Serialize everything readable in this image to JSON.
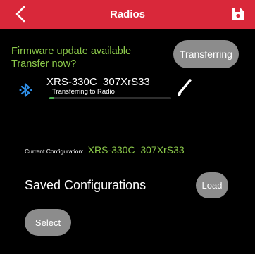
{
  "header": {
    "title": "Radios",
    "back_icon": "chevron-left-icon",
    "save_icon": "floppy-disk-icon",
    "background": "#d9283a"
  },
  "firmware": {
    "line1": "Firmware update available",
    "line2": "Transfer now?",
    "button_label": "Transferring",
    "text_color": "#8bc94a"
  },
  "device": {
    "icon": "bluetooth-icon",
    "name": "XRS-330C_307XrS33",
    "status": "Transferring to Radio",
    "progress": 0.04,
    "edit_icon": "pencil-icon",
    "progress_color": "#4caf50"
  },
  "config": {
    "label": "Current Configuration:",
    "value": "XRS-330C_307XrS33"
  },
  "saved": {
    "title": "Saved Configurations",
    "load_label": "Load",
    "select_label": "Select"
  }
}
